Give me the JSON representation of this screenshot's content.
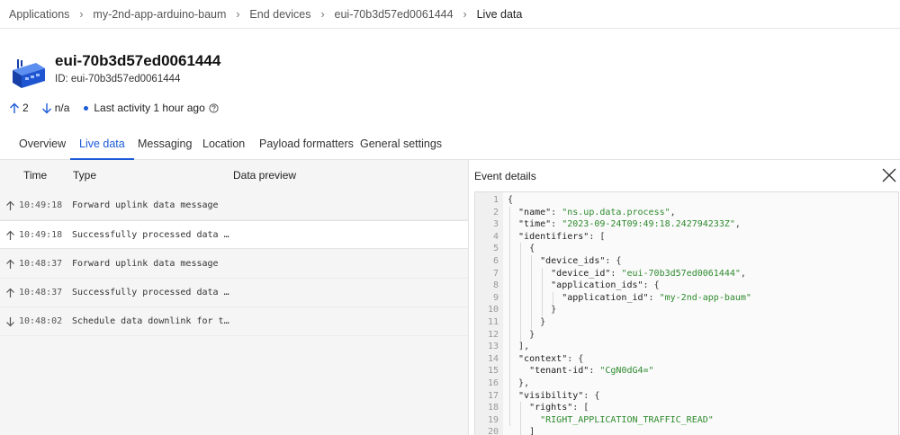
{
  "breadcrumb": [
    "Applications",
    "my-2nd-app-arduino-baum",
    "End devices",
    "eui-70b3d57ed0061444",
    "Live data"
  ],
  "device": {
    "title": "eui-70b3d57ed0061444",
    "id_label": "ID: eui-70b3d57ed0061444",
    "icon": "gateway-device-icon"
  },
  "stats": {
    "uplink_count": "2",
    "downlink_count": "n/a",
    "last_activity": "Last activity 1 hour ago"
  },
  "tabs": [
    "Overview",
    "Live data",
    "Messaging",
    "Location",
    "Payload formatters",
    "General settings"
  ],
  "active_tab": "Live data",
  "events_table": {
    "headers": [
      "Time",
      "Type",
      "Data preview"
    ],
    "rows": [
      {
        "direction": "up",
        "time": "10:49:18",
        "type": "Forward uplink data message"
      },
      {
        "direction": "up",
        "time": "10:49:18",
        "type": "Successfully processed data …"
      },
      {
        "direction": "up",
        "time": "10:48:37",
        "type": "Forward uplink data message"
      },
      {
        "direction": "up",
        "time": "10:48:37",
        "type": "Successfully processed data …"
      },
      {
        "direction": "down",
        "time": "10:48:02",
        "type": "Schedule data downlink for t…"
      }
    ]
  },
  "event_details": {
    "title": "Event details",
    "lines": [
      [
        [
          "br",
          "{"
        ]
      ],
      [
        [
          "k",
          "  \"name\""
        ],
        [
          "p",
          ": "
        ],
        [
          "s",
          "\"ns.up.data.process\""
        ],
        [
          "p",
          ","
        ]
      ],
      [
        [
          "k",
          "  \"time\""
        ],
        [
          "p",
          ": "
        ],
        [
          "s",
          "\"2023-09-24T09:49:18.242794233Z\""
        ],
        [
          "p",
          ","
        ]
      ],
      [
        [
          "k",
          "  \"identifiers\""
        ],
        [
          "p",
          ": "
        ],
        [
          "br",
          "["
        ]
      ],
      [
        [
          "br",
          "    {"
        ]
      ],
      [
        [
          "k",
          "      \"device_ids\""
        ],
        [
          "p",
          ": "
        ],
        [
          "br",
          "{"
        ]
      ],
      [
        [
          "k",
          "        \"device_id\""
        ],
        [
          "p",
          ": "
        ],
        [
          "s",
          "\"eui-70b3d57ed0061444\""
        ],
        [
          "p",
          ","
        ]
      ],
      [
        [
          "k",
          "        \"application_ids\""
        ],
        [
          "p",
          ": "
        ],
        [
          "br",
          "{"
        ]
      ],
      [
        [
          "k",
          "          \"application_id\""
        ],
        [
          "p",
          ": "
        ],
        [
          "s",
          "\"my-2nd-app-baum\""
        ]
      ],
      [
        [
          "br",
          "        }"
        ]
      ],
      [
        [
          "br",
          "      }"
        ]
      ],
      [
        [
          "br",
          "    }"
        ]
      ],
      [
        [
          "br",
          "  ]"
        ],
        [
          "p",
          ","
        ]
      ],
      [
        [
          "k",
          "  \"context\""
        ],
        [
          "p",
          ": "
        ],
        [
          "br",
          "{"
        ]
      ],
      [
        [
          "k",
          "    \"tenant-id\""
        ],
        [
          "p",
          ": "
        ],
        [
          "s",
          "\"CgN0dG4=\""
        ]
      ],
      [
        [
          "br",
          "  }"
        ],
        [
          "p",
          ","
        ]
      ],
      [
        [
          "k",
          "  \"visibility\""
        ],
        [
          "p",
          ": "
        ],
        [
          "br",
          "{"
        ]
      ],
      [
        [
          "k",
          "    \"rights\""
        ],
        [
          "p",
          ": "
        ],
        [
          "br",
          "["
        ]
      ],
      [
        [
          "s",
          "      \"RIGHT_APPLICATION_TRAFFIC_READ\""
        ]
      ],
      [
        [
          "br",
          "    ]"
        ]
      ]
    ]
  },
  "colors": {
    "accent": "#1c5bd8",
    "json_string": "#2e8a2e"
  }
}
